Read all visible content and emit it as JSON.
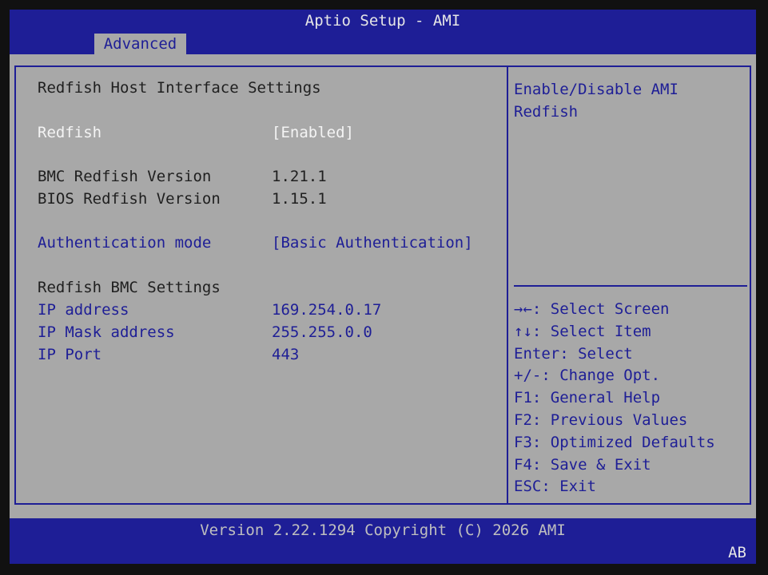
{
  "header": {
    "title": "Aptio Setup - AMI",
    "active_tab": "Advanced"
  },
  "page": {
    "heading": "Redfish Host Interface Settings",
    "redfish": {
      "label": "Redfish",
      "value": "[Enabled]"
    },
    "bmc_version": {
      "label": "BMC Redfish Version",
      "value": "1.21.1"
    },
    "bios_version": {
      "label": "BIOS Redfish Version",
      "value": "1.15.1"
    },
    "auth_mode": {
      "label": "Authentication mode",
      "value": "[Basic Authentication]"
    },
    "bmc_settings_heading": "Redfish BMC Settings",
    "ip_address": {
      "label": "IP address",
      "value": "169.254.0.17"
    },
    "ip_mask": {
      "label": "IP Mask address",
      "value": "255.255.0.0"
    },
    "ip_port": {
      "label": "IP Port",
      "value": "443"
    }
  },
  "help": {
    "text": "Enable/Disable AMI Redfish"
  },
  "keys": [
    "→←: Select Screen",
    "↑↓: Select Item",
    "Enter: Select",
    "+/-: Change Opt.",
    "F1: General Help",
    "F2: Previous Values",
    "F3: Optimized Defaults",
    "F4: Save & Exit",
    "ESC: Exit"
  ],
  "footer": {
    "version": "Version 2.22.1294 Copyright (C) 2026 AMI",
    "code": "AB"
  },
  "colors": {
    "bar_blue": "#1e1e96",
    "panel_gray": "#a8a8a8",
    "selected_white": "#f4f4f4"
  }
}
